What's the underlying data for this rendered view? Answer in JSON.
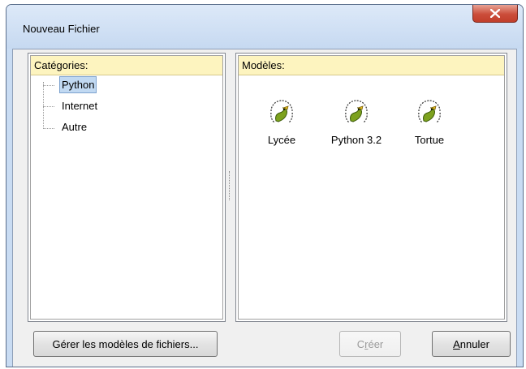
{
  "window": {
    "title": "Nouveau Fichier",
    "close_icon": "close-icon"
  },
  "categories": {
    "header": "Catégories:",
    "items": [
      {
        "label": "Python",
        "selected": true
      },
      {
        "label": "Internet",
        "selected": false
      },
      {
        "label": "Autre",
        "selected": false
      }
    ]
  },
  "templates": {
    "header": "Modèles:",
    "items": [
      {
        "label": "Lycée",
        "icon": "amiens-python-logo-icon"
      },
      {
        "label": "Python 3.2",
        "icon": "amiens-python-logo-icon"
      },
      {
        "label": "Tortue",
        "icon": "amiens-python-logo-icon"
      }
    ]
  },
  "buttons": {
    "manage": "Gérer les modèles de fichiers...",
    "create_prefix": "C",
    "create_mnemonic": "r",
    "create_suffix": "éer",
    "cancel_mnemonic": "A",
    "cancel_suffix": "nnuler"
  },
  "colors": {
    "header_bg": "#fdf4bf",
    "selection": "#c1d9f2",
    "close_button": "#c94a37"
  }
}
